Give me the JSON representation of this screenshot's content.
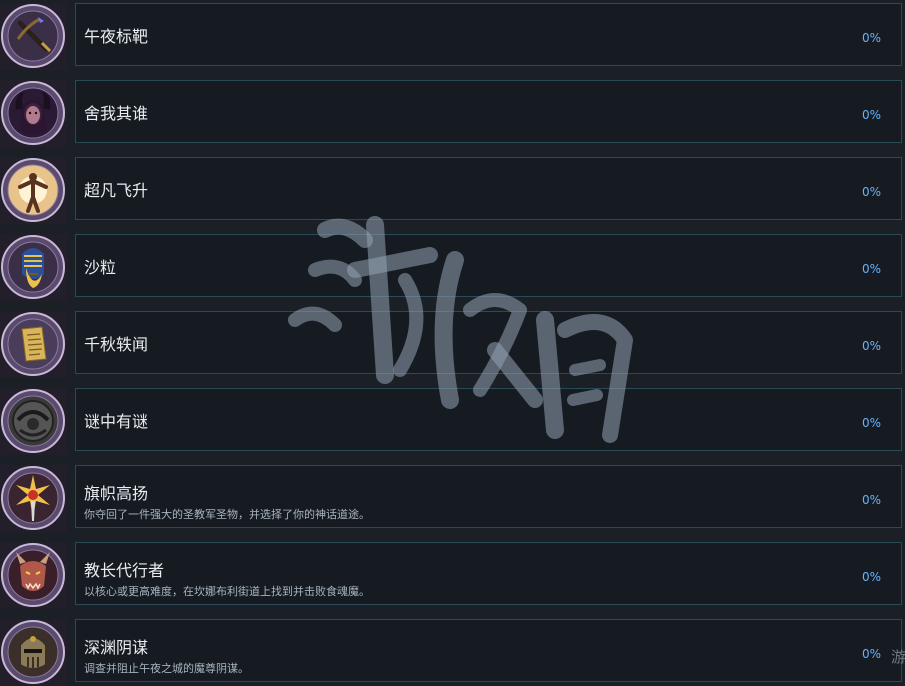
{
  "achievements": [
    {
      "title": "午夜标靶",
      "description": "",
      "progress": "0%",
      "icon": "crossbow-icon"
    },
    {
      "title": "舍我其谁",
      "description": "",
      "progress": "0%",
      "icon": "succubus-portrait-icon"
    },
    {
      "title": "超凡飞升",
      "description": "",
      "progress": "0%",
      "icon": "ascending-figure-icon"
    },
    {
      "title": "沙粒",
      "description": "",
      "progress": "0%",
      "icon": "golden-mask-icon"
    },
    {
      "title": "千秋轶闻",
      "description": "",
      "progress": "0%",
      "icon": "scroll-icon"
    },
    {
      "title": "谜中有谜",
      "description": "",
      "progress": "0%",
      "icon": "stone-seal-icon"
    },
    {
      "title": "旗帜高扬",
      "description": "你夺回了一件强大的圣教军圣物，并选择了你的神话道途。",
      "progress": "0%",
      "icon": "holy-sword-icon"
    },
    {
      "title": "教长代行者",
      "description": "以核心或更高难度，在坎娜布利街道上找到并击败食魂魔。",
      "progress": "0%",
      "icon": "demon-head-icon"
    },
    {
      "title": "深渊阴谋",
      "description": "调查并阻止午夜之城的魔尊阴谋。",
      "progress": "0%",
      "icon": "armored-helmet-icon"
    }
  ],
  "overlay": {
    "watermark_icon": "calligraphy-watermark",
    "edge_text": "游 转"
  },
  "colors": {
    "background": "#1b2027",
    "panel": "#161b22",
    "panel_border": "#2b4a58",
    "progress": "#66b3ff"
  }
}
